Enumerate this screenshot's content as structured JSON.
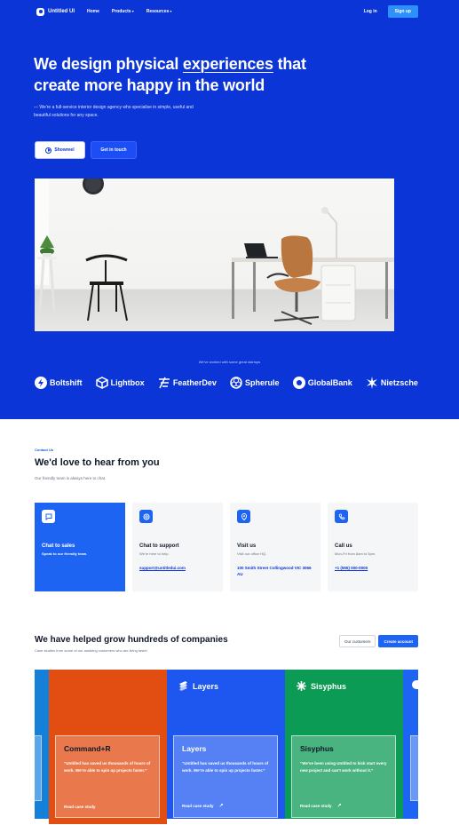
{
  "nav": {
    "brand": "Untitled UI",
    "links": [
      "Home",
      "Products",
      "Resources"
    ],
    "login": "Log in",
    "signup": "Sign up"
  },
  "hero": {
    "title_pre": "We design physical ",
    "title_em": "experiences",
    "title_post": " that create more happy in the world",
    "subtitle": "— We're a full-service interior design agency who specialise in simple, useful and beautiful solutions for any space.",
    "btn_showreel": "Showreel",
    "btn_touch": "Get in touch",
    "startups_caption": "We've worked with some great startups",
    "logos": [
      "Boltshift",
      "Lightbox",
      "FeatherDev",
      "Spherule",
      "GlobalBank",
      "Nietzsche"
    ]
  },
  "contact": {
    "eyebrow": "Contact Us",
    "title": "We'd love to hear from you",
    "subtitle": "Our friendly team is always here to chat.",
    "cards": [
      {
        "title": "Chat to sales",
        "desc": "Speak to our friendly team.",
        "link": "",
        "icon": "chat-icon"
      },
      {
        "title": "Chat to support",
        "desc": "We're here to help.",
        "link": "support@untitledui.com",
        "icon": "support-icon"
      },
      {
        "title": "Visit us",
        "desc": "Visit our office HQ.",
        "link": "100 Smith Street Collingwood VIC 3066 AU",
        "icon": "map-pin-icon"
      },
      {
        "title": "Call us",
        "desc": "Mon-Fri from 8am to 5pm.",
        "link": "+1 (555) 000-0000",
        "icon": "phone-icon"
      }
    ]
  },
  "cases": {
    "title": "We have helped grow hundreds of companies",
    "subtitle": "Case studies from some of our amazing customers who are living faster",
    "btn_customers": "Our customers",
    "btn_create": "Create account",
    "items": [
      {
        "name": "Command+R",
        "brand": "",
        "quote": "“Untitled has saved us thousands of hours of work. We're able to spin up projects faster.”",
        "link": "Read case study",
        "color": "#e24d12"
      },
      {
        "name": "Layers",
        "brand": "Layers",
        "quote": "“Untitled has saved us thousands of hours of work. We're able to spin up projects faster.”",
        "link": "Read case study",
        "color": "#1d57f0"
      },
      {
        "name": "Sisyphus",
        "brand": "Sisyphus",
        "quote": "“We've been using Untitled to kick start every new project and can't work without it.”",
        "link": "Read case study",
        "color": "#0c9b55"
      }
    ]
  },
  "colors": {
    "hero_bg": "#0b35d6",
    "accent": "#1d64f2"
  }
}
